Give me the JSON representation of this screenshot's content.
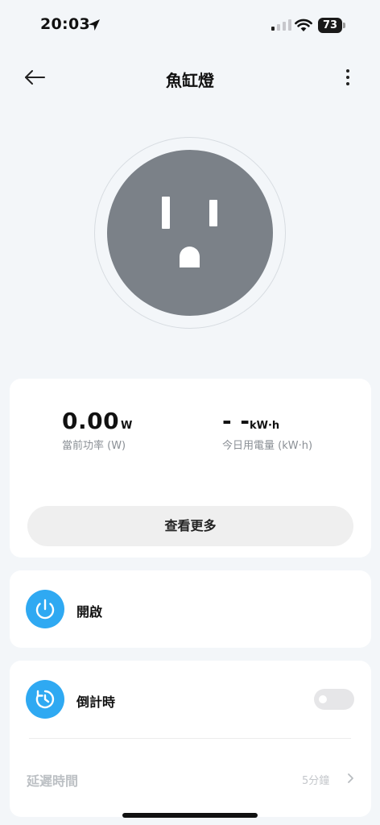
{
  "status_bar": {
    "time": "20:03",
    "battery": "73",
    "icons": [
      "location-arrow-icon",
      "cellular-signal-icon",
      "wifi-icon",
      "battery-icon"
    ]
  },
  "nav": {
    "title": "魚缸燈",
    "back_icon": "back-arrow-icon",
    "more_icon": "more-vertical-icon"
  },
  "socket": {
    "icon": "us-outlet-icon",
    "face_color": "#7b8188"
  },
  "energy": {
    "current_power": {
      "value": "0.00",
      "unit": "W",
      "label": "當前功率 (W)"
    },
    "today_usage": {
      "value": "- -",
      "unit": "kW·h",
      "label": "今日用電量 (kW·h)"
    },
    "more_button": "查看更多"
  },
  "power": {
    "label": "開啟",
    "icon": "power-icon",
    "accent": "#2fa9f2"
  },
  "timer": {
    "label": "倒計時",
    "icon": "countdown-timer-icon",
    "toggle_on": false,
    "delay_label": "延遲時間",
    "delay_value": "5分鐘",
    "chevron_icon": "chevron-right-icon"
  }
}
